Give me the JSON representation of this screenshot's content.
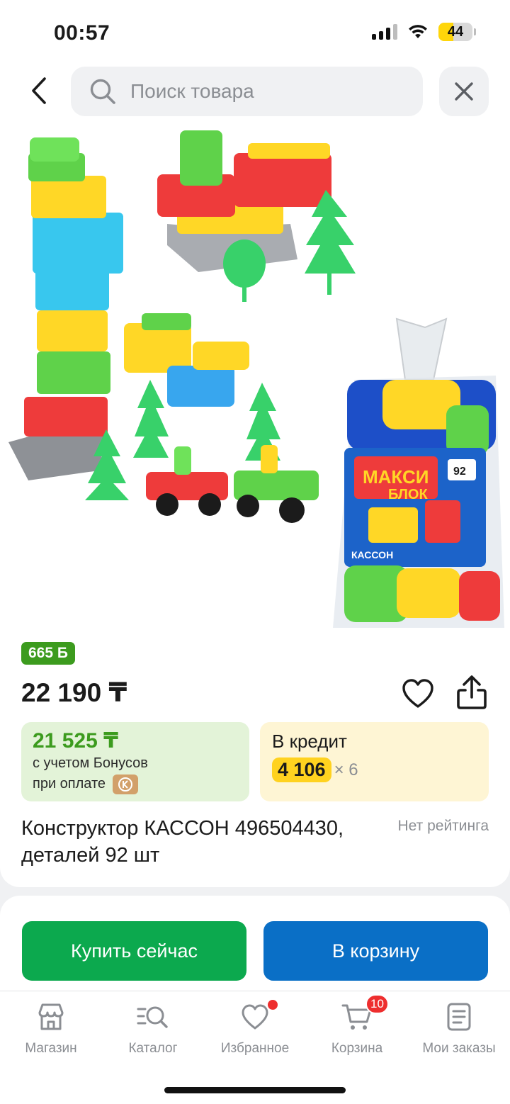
{
  "status_bar": {
    "time": "00:57",
    "battery": "44",
    "battery_level": 0.44
  },
  "search": {
    "placeholder": "Поиск товара"
  },
  "product": {
    "bonus_badge": "665 Б",
    "price": "22 190 ₸",
    "bonus_price": {
      "amount": "21 525 ₸",
      "line1": "с учетом Бонусов",
      "line2": "при оплате"
    },
    "credit": {
      "title": "В кредит",
      "monthly": "4 106",
      "multiplier": "× 6"
    },
    "title": "Конструктор КАССОН 496504430, деталей 92 шт",
    "rating": "Нет рейтинга",
    "package_label": {
      "brand_line1": "МАКСИ",
      "brand_line2": "БЛОК",
      "count": "92",
      "maker": "КАССОН"
    }
  },
  "actions": {
    "buy_now": "Купить сейчас",
    "add_to_cart": "В корзину"
  },
  "tabbar": {
    "items": [
      {
        "label": "Магазин"
      },
      {
        "label": "Каталог"
      },
      {
        "label": "Избранное"
      },
      {
        "label": "Корзина",
        "badge": "10"
      },
      {
        "label": "Мои заказы"
      }
    ]
  },
  "colors": {
    "green_button": "#0ca94e",
    "blue_button": "#0a6fc6",
    "bonus_green": "#3c9b1e",
    "credit_yellow": "#ffd21f",
    "badge_red": "#ee2e2e"
  }
}
